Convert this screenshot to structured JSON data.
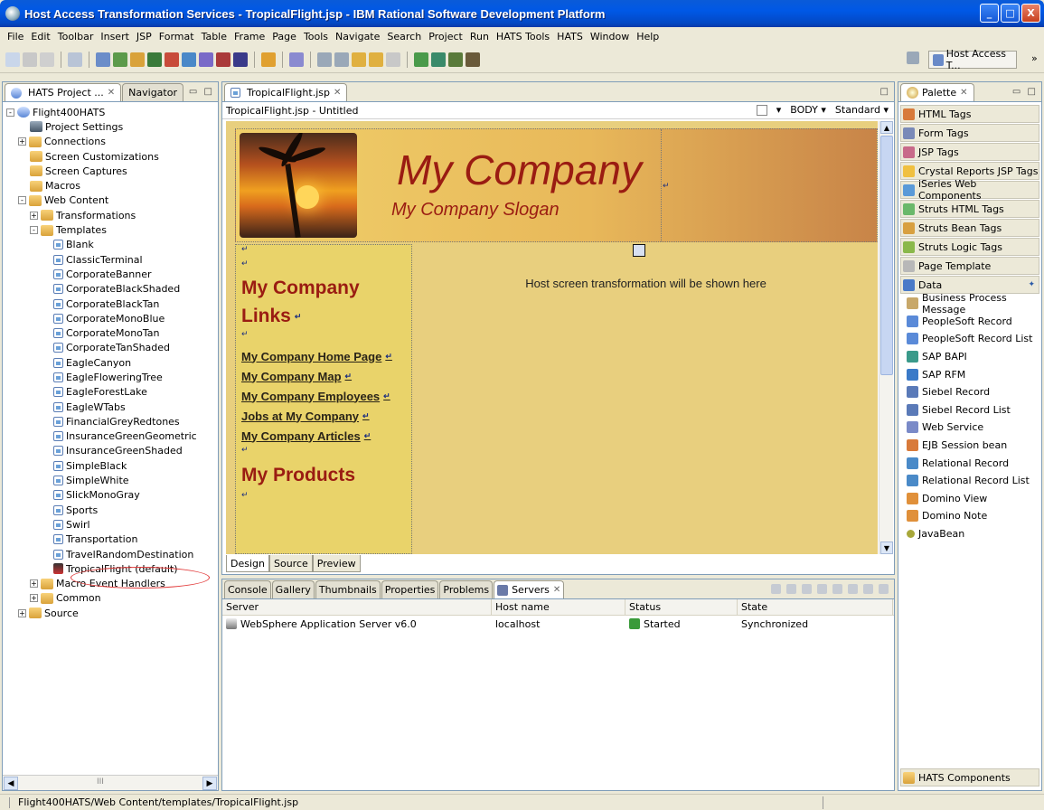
{
  "window": {
    "title": "Host Access Transformation Services - TropicalFlight.jsp - IBM Rational Software Development Platform",
    "controls": {
      "minimize": "_",
      "maximize": "□",
      "close": "X"
    }
  },
  "menu": [
    "File",
    "Edit",
    "Toolbar",
    "Insert",
    "JSP",
    "Format",
    "Table",
    "Frame",
    "Page",
    "Tools",
    "Navigate",
    "Search",
    "Project",
    "Run",
    "HATS Tools",
    "HATS",
    "Window",
    "Help"
  ],
  "perspective": {
    "label": "Host Access T...",
    "more": "»"
  },
  "left_panel": {
    "tabs": [
      {
        "label": "HATS Project ...",
        "close": "✕"
      },
      {
        "label": "Navigator"
      }
    ],
    "tree": [
      {
        "label": "Flight400HATS",
        "level": 0,
        "exp": "-",
        "icon": "project"
      },
      {
        "label": "Project Settings",
        "level": 2,
        "icon": "settings"
      },
      {
        "label": "Connections",
        "level": 1,
        "exp": "+",
        "icon": "folder"
      },
      {
        "label": "Screen Customizations",
        "level": 2,
        "icon": "folder"
      },
      {
        "label": "Screen Captures",
        "level": 2,
        "icon": "folder"
      },
      {
        "label": "Macros",
        "level": 2,
        "icon": "folder"
      },
      {
        "label": "Web Content",
        "level": 1,
        "exp": "-",
        "icon": "folder"
      },
      {
        "label": "Transformations",
        "level": 2,
        "exp": "+",
        "icon": "folder"
      },
      {
        "label": "Templates",
        "level": 2,
        "exp": "-",
        "icon": "folder"
      },
      {
        "label": "Blank",
        "level": 4,
        "icon": "page"
      },
      {
        "label": "ClassicTerminal",
        "level": 4,
        "icon": "page"
      },
      {
        "label": "CorporateBanner",
        "level": 4,
        "icon": "page"
      },
      {
        "label": "CorporateBlackShaded",
        "level": 4,
        "icon": "page"
      },
      {
        "label": "CorporateBlackTan",
        "level": 4,
        "icon": "page"
      },
      {
        "label": "CorporateMonoBlue",
        "level": 4,
        "icon": "page"
      },
      {
        "label": "CorporateMonoTan",
        "level": 4,
        "icon": "page"
      },
      {
        "label": "CorporateTanShaded",
        "level": 4,
        "icon": "page"
      },
      {
        "label": "EagleCanyon",
        "level": 4,
        "icon": "page"
      },
      {
        "label": "EagleFloweringTree",
        "level": 4,
        "icon": "page"
      },
      {
        "label": "EagleForestLake",
        "level": 4,
        "icon": "page"
      },
      {
        "label": "EagleWTabs",
        "level": 4,
        "icon": "page"
      },
      {
        "label": "FinancialGreyRedtones",
        "level": 4,
        "icon": "page"
      },
      {
        "label": "InsuranceGreenGeometric",
        "level": 4,
        "icon": "page"
      },
      {
        "label": "InsuranceGreenShaded",
        "level": 4,
        "icon": "page"
      },
      {
        "label": "SimpleBlack",
        "level": 4,
        "icon": "page"
      },
      {
        "label": "SimpleWhite",
        "level": 4,
        "icon": "page"
      },
      {
        "label": "SlickMonoGray",
        "level": 4,
        "icon": "page"
      },
      {
        "label": "Sports",
        "level": 4,
        "icon": "page"
      },
      {
        "label": "Swirl",
        "level": 4,
        "icon": "page"
      },
      {
        "label": "Transportation",
        "level": 4,
        "icon": "page"
      },
      {
        "label": "TravelRandomDestination",
        "level": 4,
        "icon": "page"
      },
      {
        "label": "TropicalFlight (default)",
        "level": 4,
        "icon": "jsp-def"
      },
      {
        "label": "Macro Event Handlers",
        "level": 2,
        "exp": "+",
        "icon": "folder"
      },
      {
        "label": "Common",
        "level": 2,
        "exp": "+",
        "icon": "folder"
      },
      {
        "label": "Source",
        "level": 1,
        "exp": "+",
        "icon": "folder"
      }
    ],
    "scroll_mid": "III"
  },
  "editor": {
    "tab": {
      "label": "TropicalFlight.jsp",
      "close": "✕"
    },
    "subtitle": "TropicalFlight.jsp - Untitled",
    "body_label": "BODY",
    "mode_label": "Standard",
    "banner": {
      "company": "My Company",
      "slogan": "My Company Slogan"
    },
    "sidebar": {
      "heading1a": "My Company",
      "heading1b": "Links",
      "links": [
        "My Company Home Page",
        "My Company Map",
        "My Company Employees",
        "Jobs at My Company",
        "My Company Articles"
      ],
      "heading2": "My Products"
    },
    "host_message": "Host screen transformation will be shown here",
    "cr": "↵",
    "bottom_tabs": [
      "Design",
      "Source",
      "Preview"
    ]
  },
  "bottom_panel": {
    "tabs": [
      "Console",
      "Gallery",
      "Thumbnails",
      "Properties",
      "Problems",
      "Servers"
    ],
    "close": "✕",
    "columns": [
      "Server",
      "Host name",
      "Status",
      "State"
    ],
    "rows": [
      {
        "server": "WebSphere Application Server v6.0",
        "host": "localhost",
        "status": "Started",
        "state": "Synchronized"
      }
    ]
  },
  "palette": {
    "tab": {
      "label": "Palette",
      "close": "✕"
    },
    "drawers": [
      "HTML Tags",
      "Form Tags",
      "JSP Tags",
      "Crystal Reports JSP Tags",
      "iSeries Web Components",
      "Struts HTML Tags",
      "Struts Bean Tags",
      "Struts Logic Tags",
      "Page Template",
      "Data"
    ],
    "items": [
      "Business Process Message",
      "PeopleSoft Record",
      "PeopleSoft Record List",
      "SAP BAPI",
      "SAP RFM",
      "Siebel Record",
      "Siebel Record List",
      "Web Service",
      "EJB Session bean",
      "Relational Record",
      "Relational Record List",
      "Domino View",
      "Domino Note",
      "JavaBean"
    ],
    "footer": "HATS Components"
  },
  "status": {
    "path": "Flight400HATS/Web Content/templates/TropicalFlight.jsp"
  },
  "colors": {
    "title_blue": "#0058e6",
    "brand_red": "#9a1c12",
    "canvas_tan": "#e8cf7e"
  }
}
